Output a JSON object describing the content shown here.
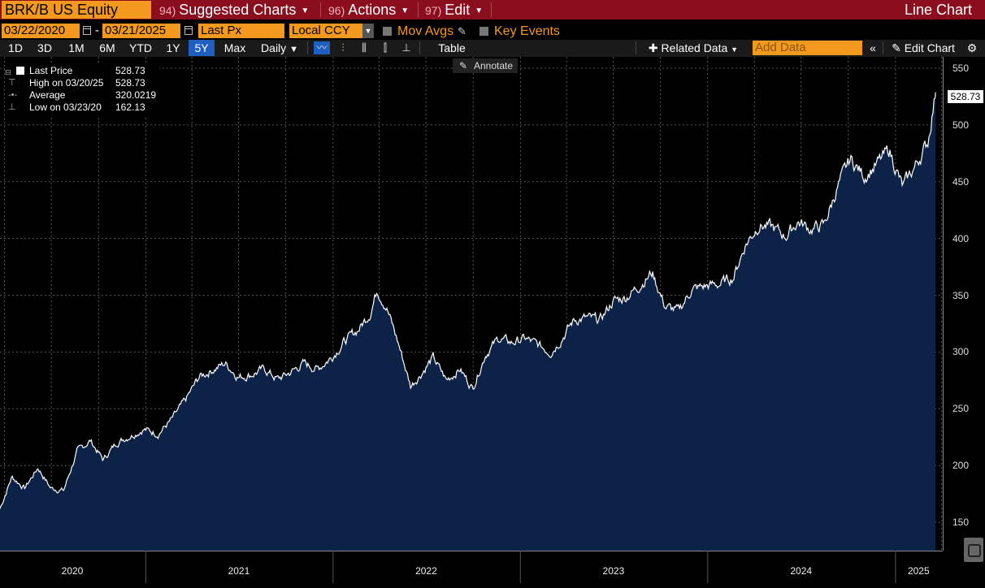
{
  "header": {
    "ticker": "BRK/B US Equity",
    "menus": [
      {
        "num": "94)",
        "label": "Suggested Charts"
      },
      {
        "num": "96)",
        "label": "Actions"
      },
      {
        "num": "97)",
        "label": "Edit"
      }
    ],
    "chart_kind": "Line Chart"
  },
  "controls": {
    "start_date": "03/22/2020",
    "end_date": "03/21/2025",
    "date_dash": "-",
    "field": "Last Px",
    "currency": "Local CCY",
    "mov_avgs": "Mov Avgs",
    "key_events": "Key Events"
  },
  "toolbar": {
    "ranges": [
      "1D",
      "3D",
      "1M",
      "6M",
      "YTD",
      "1Y",
      "5Y",
      "Max"
    ],
    "active_range": "5Y",
    "frequency": "Daily",
    "table": "Table",
    "related_data": "Related Data",
    "add_data_placeholder": "Add Data",
    "edit_chart": "Edit Chart",
    "annotate": "Annotate"
  },
  "legend": [
    {
      "label": "Last Price",
      "value": "528.73"
    },
    {
      "label": "High on 03/20/25",
      "value": "528.73"
    },
    {
      "label": "Average",
      "value": "320.0219"
    },
    {
      "label": "Low on 03/23/20",
      "value": "162.13"
    }
  ],
  "colors": {
    "accent_orange": "#f39a1e",
    "title_bar": "#8a0e1d",
    "area_fill": "#0c2347",
    "line": "#ffffff",
    "active_button": "#1f5fc2"
  },
  "chart_data": {
    "type": "area",
    "title": "",
    "xlabel": "",
    "ylabel": "",
    "ylim": [
      125,
      560
    ],
    "yticks": [
      150,
      200,
      250,
      300,
      350,
      400,
      450,
      500,
      550
    ],
    "x_year_labels": [
      "2020",
      "2021",
      "2022",
      "2023",
      "2024",
      "2025"
    ],
    "last_value_label": "528.73",
    "grid": true,
    "series": [
      {
        "values_note_free": true,
        "x": [
          "2020-03-23",
          "2020-04-15",
          "2020-05-10",
          "2020-06-05",
          "2020-06-30",
          "2020-07-25",
          "2020-08-20",
          "2020-09-15",
          "2020-10-10",
          "2020-11-05",
          "2020-12-01",
          "2020-12-28",
          "2021-01-25",
          "2021-02-20",
          "2021-03-20",
          "2021-04-15",
          "2021-05-10",
          "2021-06-05",
          "2021-07-01",
          "2021-07-25",
          "2021-08-20",
          "2021-09-15",
          "2021-10-10",
          "2021-11-05",
          "2021-12-01",
          "2021-12-28",
          "2022-01-25",
          "2022-02-20",
          "2022-03-15",
          "2022-03-28",
          "2022-04-15",
          "2022-05-10",
          "2022-06-01",
          "2022-06-20",
          "2022-07-15",
          "2022-08-10",
          "2022-09-05",
          "2022-09-30",
          "2022-10-25",
          "2022-11-20",
          "2022-12-15",
          "2023-01-10",
          "2023-02-05",
          "2023-03-01",
          "2023-03-20",
          "2023-04-15",
          "2023-05-10",
          "2023-06-05",
          "2023-07-01",
          "2023-07-25",
          "2023-08-20",
          "2023-09-15",
          "2023-10-10",
          "2023-11-05",
          "2023-12-01",
          "2023-12-28",
          "2024-01-25",
          "2024-02-20",
          "2024-03-15",
          "2024-04-10",
          "2024-05-05",
          "2024-06-01",
          "2024-06-25",
          "2024-07-20",
          "2024-08-15",
          "2024-09-10",
          "2024-10-05",
          "2024-11-01",
          "2024-11-25",
          "2024-12-20",
          "2025-01-15",
          "2025-02-10",
          "2025-03-05",
          "2025-03-20"
        ],
        "values": [
          162,
          190,
          180,
          198,
          180,
          178,
          212,
          222,
          205,
          220,
          226,
          232,
          228,
          240,
          258,
          278,
          284,
          290,
          278,
          280,
          285,
          276,
          282,
          290,
          285,
          295,
          310,
          320,
          335,
          355,
          340,
          305,
          270,
          280,
          295,
          275,
          285,
          268,
          298,
          312,
          308,
          312,
          306,
          300,
          310,
          328,
          330,
          328,
          345,
          348,
          358,
          370,
          340,
          336,
          355,
          358,
          360,
          366,
          395,
          412,
          410,
          402,
          415,
          408,
          412,
          445,
          470,
          455,
          465,
          478,
          445,
          465,
          485,
          528.73
        ]
      }
    ]
  }
}
